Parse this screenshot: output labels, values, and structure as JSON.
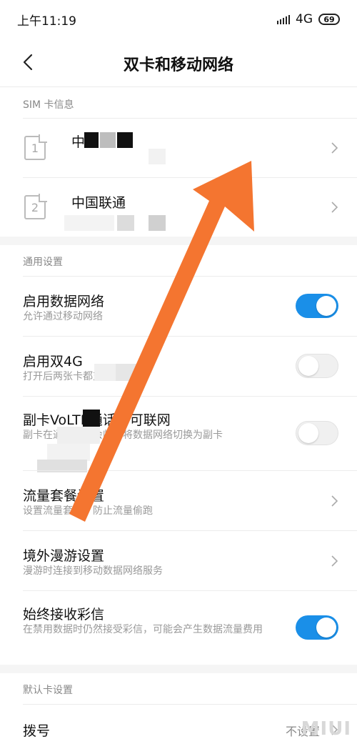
{
  "status_bar": {
    "time": "上午11:19",
    "network": "4G",
    "battery": "69"
  },
  "header": {
    "title": "双卡和移动网络"
  },
  "sim_section": {
    "header": "SIM 卡信息",
    "cards": [
      {
        "slot": "1",
        "name": "中"
      },
      {
        "slot": "2",
        "name": "中国联通"
      }
    ]
  },
  "general_section": {
    "header": "通用设置",
    "items": [
      {
        "title": "启用数据网络",
        "subtitle": "允许通过移动网络",
        "toggle": "on"
      },
      {
        "title": "启用双4G",
        "subtitle": "打开后两张卡都支持4G",
        "toggle": "off"
      },
      {
        "title": "副卡VoLTE通话时可联网",
        "subtitle": "副卡在通话期间会临时将数据网络切换为副卡",
        "toggle": "off"
      },
      {
        "title": "流量套餐设置",
        "subtitle": "设置流量套餐，防止流量偷跑"
      },
      {
        "title": "境外漫游设置",
        "subtitle": "漫游时连接到移动数据网络服务"
      },
      {
        "title": "始终接收彩信",
        "subtitle": "在禁用数据时仍然接受彩信，可能会产生数据流量费用",
        "toggle": "on"
      }
    ]
  },
  "default_section": {
    "header": "默认卡设置",
    "items": [
      {
        "title": "拨号",
        "value": "不设置"
      }
    ]
  },
  "watermark": "MIUI",
  "colors": {
    "accent": "#1a8fe8",
    "arrow": "#f47530"
  }
}
